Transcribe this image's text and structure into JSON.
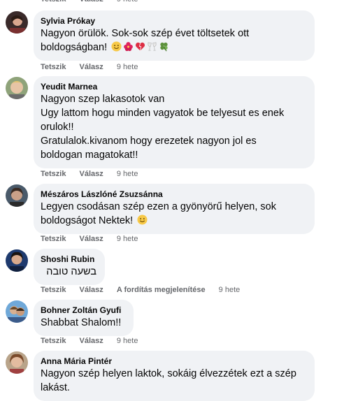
{
  "actions": {
    "like": "Tetszik",
    "reply": "Válasz",
    "translate": "A fordítás megjelenítése",
    "time": "9 hete"
  },
  "comments": [
    {
      "name": "Sylvia Prókay",
      "lines": [
        "Nagyon örülök. Sok-sok szép évet töltsetek ott",
        "boldogságban!"
      ],
      "emojis": [
        "smiling-face-icon",
        "hibiscus-icon",
        "heart-icon",
        "champagne-toast-icon",
        "four-leaf-clover-icon"
      ]
    },
    {
      "name": "Yeudit Marnea",
      "lines": [
        "Nagyon szep lakasotok van",
        "Ugy lattom hogu minden vagyatok be telyesut es enek",
        "orulok!!",
        "Gratulalok.kivanom hogy erezetek nagyon jol es",
        "boldogan magatokat!!"
      ]
    },
    {
      "name": "Mészáros Lászlóné Zsuzsánna",
      "lines": [
        "Legyen csodásan szép ezen a gyönyörű helyen, sok",
        "boldogságot Nektek!"
      ],
      "emojis": [
        "smiling-face-icon"
      ]
    },
    {
      "name": "Shoshi Rubin",
      "lines": [
        "בשעה טובה"
      ]
    },
    {
      "name": "Bohner Zoltán Gyufi",
      "lines": [
        "Shabbat Shalom!!"
      ]
    },
    {
      "name": "Anna Mária Pintér",
      "lines": [
        "Nagyon szép helyen laktok, sokáig élvezzétek ezt a szép",
        "lakást."
      ]
    }
  ]
}
